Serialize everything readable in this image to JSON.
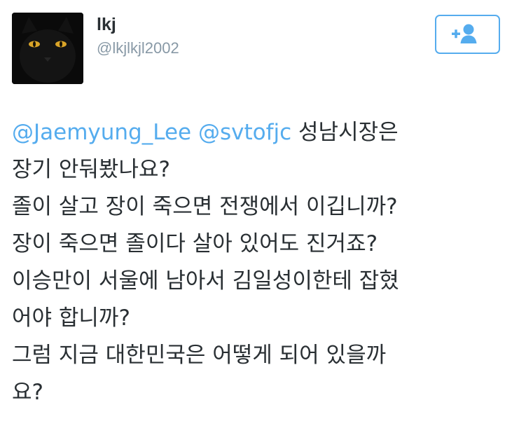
{
  "user": {
    "display_name": "lkj",
    "handle": "@lkjlkjl2002",
    "avatar_icon": "black-cat-avatar"
  },
  "follow_button": {
    "icon": "follow-icon"
  },
  "tweet": {
    "mentions": [
      "@Jaemyung_Lee",
      "@svtofjc"
    ],
    "first_line_rest": "성남시장은",
    "lines": [
      "장기 안둬봤나요?",
      "졸이 살고 장이 죽으면 전쟁에서 이깁니까?",
      "장이 죽으면 졸이다 살아 있어도 진거죠?",
      "이승만이 서울에 남아서 김일성이한테 잡혔",
      "어야 합니까?",
      "그럼 지금 대한민국은 어떻게 되어 있을까",
      "요?"
    ]
  },
  "colors": {
    "link": "#55acee",
    "text": "#292f33",
    "muted": "#8899a6"
  }
}
